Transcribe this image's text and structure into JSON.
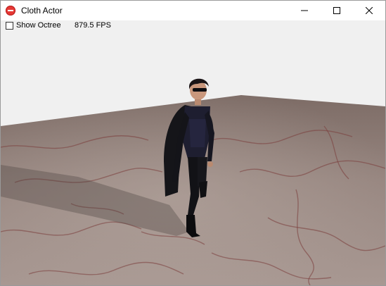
{
  "window": {
    "title": "Cloth Actor",
    "app_icon": "stop-sign-icon",
    "controls": [
      "minimize-icon",
      "maximize-icon",
      "close-icon"
    ]
  },
  "viewport": {
    "show_octree_label": "Show Octree",
    "show_octree_checked": false,
    "fps_text": "879.5 FPS"
  },
  "colors": {
    "background": "#f0f0f0",
    "floor": "#8d7c74",
    "vein": "#7a3d3a",
    "character_suit": "#1a1a22"
  }
}
